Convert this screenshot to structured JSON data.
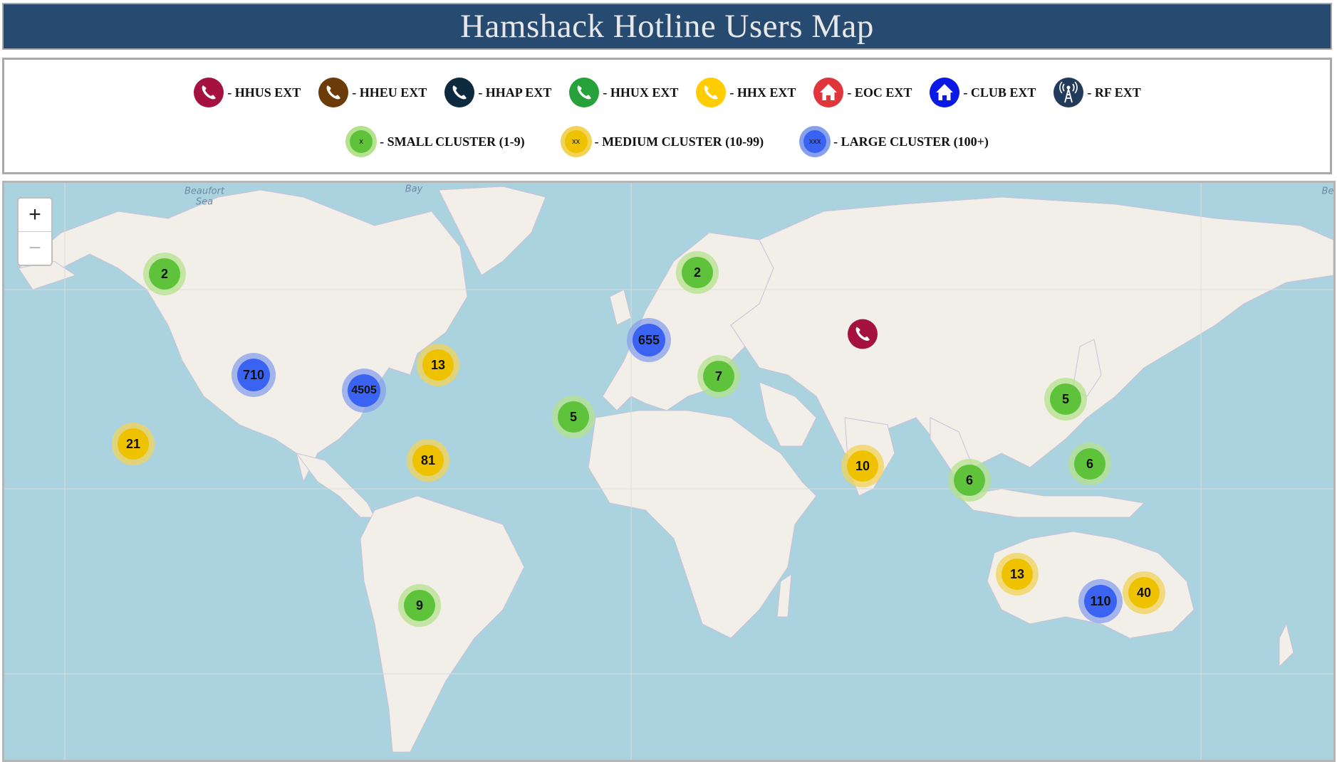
{
  "header": {
    "title": "Hamshack Hotline Users Map"
  },
  "legend": {
    "extensions": [
      {
        "label": "- HHUS EXT",
        "icon": "phone-icon",
        "color": "#a5123f"
      },
      {
        "label": "- HHEU EXT",
        "icon": "phone-icon",
        "color": "#6b3c08"
      },
      {
        "label": "- HHAP EXT",
        "icon": "phone-icon",
        "color": "#0d2a3f"
      },
      {
        "label": "- HHUX EXT",
        "icon": "phone-icon",
        "color": "#27a23a"
      },
      {
        "label": "- HHX EXT",
        "icon": "phone-icon",
        "color": "#ffcd00"
      },
      {
        "label": "- EOC EXT",
        "icon": "house-icon",
        "color": "#e0353b"
      },
      {
        "label": "- CLUB EXT",
        "icon": "house-icon",
        "color": "#0a19e6"
      },
      {
        "label": "- RF EXT",
        "icon": "radio-tower-icon",
        "color": "#223b5b"
      }
    ],
    "clusters": [
      {
        "label": "- SMALL CLUSTER (1-9)",
        "swatch_text": "x",
        "color": "#5ec23b",
        "halo": "#b5e28c"
      },
      {
        "label": "- MEDIUM CLUSTER (10-99)",
        "swatch_text": "xx",
        "color": "#efc200",
        "halo": "#f1d357"
      },
      {
        "label": "- LARGE CLUSTER (100+)",
        "swatch_text": "xxx",
        "color": "#3a63f1",
        "halo": "#87a0eb"
      }
    ]
  },
  "map": {
    "zoom": {
      "in_label": "+",
      "out_label": "−"
    },
    "place_labels": [
      {
        "text": "Beaufort",
        "region": "beaufort-sea"
      },
      {
        "text": "Sea",
        "region": "beaufort-sea"
      },
      {
        "text": "Bay",
        "region": "baffin-bay"
      },
      {
        "text": "Be",
        "region": "bering-sea"
      }
    ],
    "clusters": [
      {
        "count": "2",
        "size": "small",
        "region": "alaska"
      },
      {
        "count": "2",
        "size": "small",
        "region": "scandinavia"
      },
      {
        "count": "655",
        "size": "large",
        "region": "western-europe"
      },
      {
        "count": "13",
        "size": "medium",
        "region": "eastern-canada"
      },
      {
        "count": "710",
        "size": "large",
        "region": "us-west"
      },
      {
        "count": "4505",
        "size": "large",
        "region": "us-east"
      },
      {
        "count": "7",
        "size": "small",
        "region": "balkans"
      },
      {
        "count": "5",
        "size": "small",
        "region": "japan"
      },
      {
        "count": "5",
        "size": "small",
        "region": "canary-islands"
      },
      {
        "count": "21",
        "size": "medium",
        "region": "hawaii"
      },
      {
        "count": "81",
        "size": "medium",
        "region": "caribbean"
      },
      {
        "count": "10",
        "size": "medium",
        "region": "india"
      },
      {
        "count": "6",
        "size": "small",
        "region": "philippines"
      },
      {
        "count": "6",
        "size": "small",
        "region": "malaysia"
      },
      {
        "count": "13",
        "size": "medium",
        "region": "western-australia"
      },
      {
        "count": "40",
        "size": "medium",
        "region": "eastern-australia"
      },
      {
        "count": "110",
        "size": "large",
        "region": "south-australia"
      },
      {
        "count": "9",
        "size": "small",
        "region": "argentina"
      }
    ],
    "markers": [
      {
        "type": "HHUS EXT",
        "icon": "phone-icon",
        "color": "#a5123f",
        "region": "siberia"
      }
    ]
  }
}
